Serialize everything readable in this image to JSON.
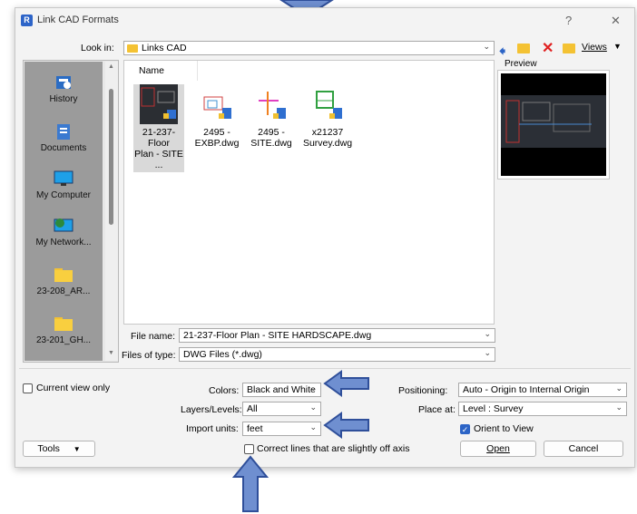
{
  "window": {
    "title": "Link CAD Formats",
    "help": "?",
    "close": "✕"
  },
  "lookin": {
    "label": "Look in:",
    "value": "Links CAD"
  },
  "toolbar": {
    "views_label": "Views"
  },
  "preview": {
    "label": "Preview"
  },
  "places": [
    {
      "label": "History"
    },
    {
      "label": "Documents"
    },
    {
      "label": "My Computer"
    },
    {
      "label": "My Network..."
    },
    {
      "label": "23-208_AR..."
    },
    {
      "label": "23-201_GH..."
    }
  ],
  "filelist": {
    "column": "Name",
    "files": [
      {
        "line1": "21-237-Floor",
        "line2": "Plan - SITE ..."
      },
      {
        "line1": "2495 -",
        "line2": "EXBP.dwg"
      },
      {
        "line1": "2495 -",
        "line2": "SITE.dwg"
      },
      {
        "line1": "x21237",
        "line2": "Survey.dwg"
      }
    ]
  },
  "filename": {
    "label": "File name:",
    "value": "21-237-Floor Plan - SITE HARDSCAPE.dwg"
  },
  "filetype": {
    "label": "Files of type:",
    "value": "DWG Files  (*.dwg)"
  },
  "options": {
    "current_view": "Current view only",
    "colors_label": "Colors:",
    "colors_value": "Black and White",
    "layers_label": "Layers/Levels:",
    "layers_value": "All",
    "units_label": "Import units:",
    "units_value": "feet",
    "correct_lines": "Correct lines that are slightly off axis",
    "positioning_label": "Positioning:",
    "positioning_value": "Auto - Origin to Internal Origin",
    "placeat_label": "Place at:",
    "placeat_value": "Level : Survey",
    "orient": "Orient to View"
  },
  "buttons": {
    "tools": "Tools",
    "open": "Open",
    "cancel": "Cancel"
  },
  "colors": {
    "accent": "#2c64c6",
    "arrow_fill": "#6f8fd0",
    "arrow_stroke": "#2f4f9a"
  }
}
